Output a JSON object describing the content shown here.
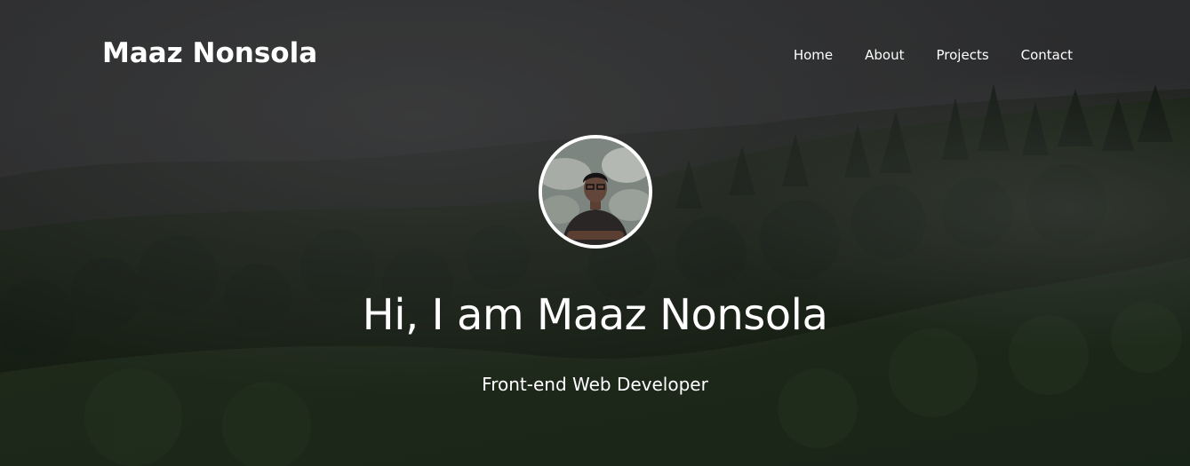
{
  "nav": {
    "brand": "Maaz Nonsola",
    "links": [
      {
        "label": "Home"
      },
      {
        "label": "About"
      },
      {
        "label": "Projects"
      },
      {
        "label": "Contact"
      }
    ]
  },
  "hero": {
    "headline": "Hi, I am Maaz Nonsola",
    "subtitle": "Front-end Web Developer"
  },
  "colors": {
    "text": "#ffffff",
    "overlay": "#2b2d2e",
    "forest": "#1f2a1e"
  }
}
